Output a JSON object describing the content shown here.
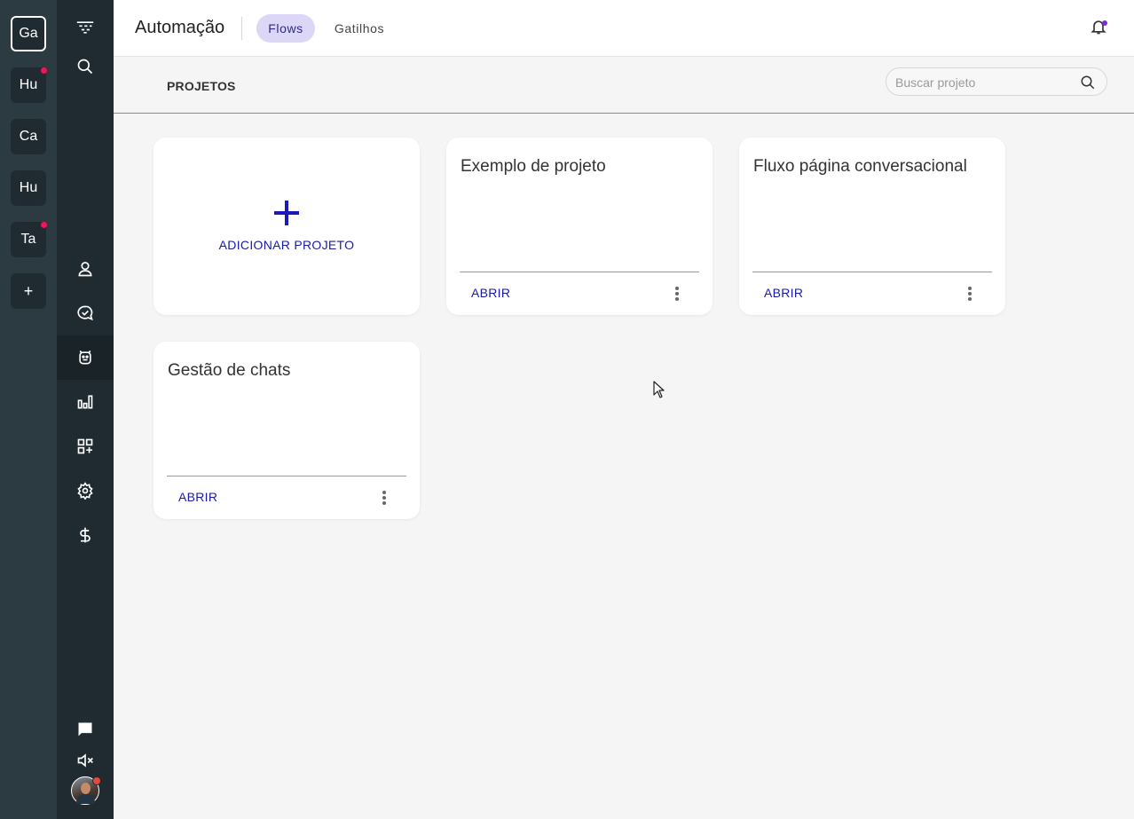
{
  "workspaces": [
    {
      "label": "Ga",
      "active": true,
      "notification": false
    },
    {
      "label": "Hu",
      "active": false,
      "notification": true
    },
    {
      "label": "Ca",
      "active": false,
      "notification": false
    },
    {
      "label": "Hu",
      "active": false,
      "notification": false
    },
    {
      "label": "Ta",
      "active": false,
      "notification": true
    },
    {
      "label": "+",
      "active": false,
      "notification": false
    }
  ],
  "nav": {
    "items": [
      "logo-icon",
      "search-icon",
      "contacts-icon",
      "chat-icon",
      "bot-icon",
      "reports-icon",
      "apps-icon",
      "settings-icon",
      "billing-icon",
      "message-icon",
      "mute-icon"
    ],
    "active": "bot-icon"
  },
  "header": {
    "title": "Automação",
    "tabs": [
      {
        "label": "Flows",
        "active": true
      },
      {
        "label": "Gatilhos",
        "active": false
      }
    ]
  },
  "subheader": {
    "title": "PROJETOS",
    "search_placeholder": "Buscar projeto",
    "search_value": ""
  },
  "add_card": {
    "label": "ADICIONAR PROJETO"
  },
  "projects": [
    {
      "name": "Exemplo de projeto",
      "open_label": "ABRIR"
    },
    {
      "name": "Fluxo página conversacional",
      "open_label": "ABRIR"
    },
    {
      "name": "Gestão de chats",
      "open_label": "ABRIR"
    }
  ],
  "colors": {
    "accent": "#1a1aa8",
    "tab_active_bg": "#dcd6f7",
    "workspace_rail": "#2c3a42",
    "nav_rail": "#202b31",
    "notification_dot": "#f0145a"
  }
}
